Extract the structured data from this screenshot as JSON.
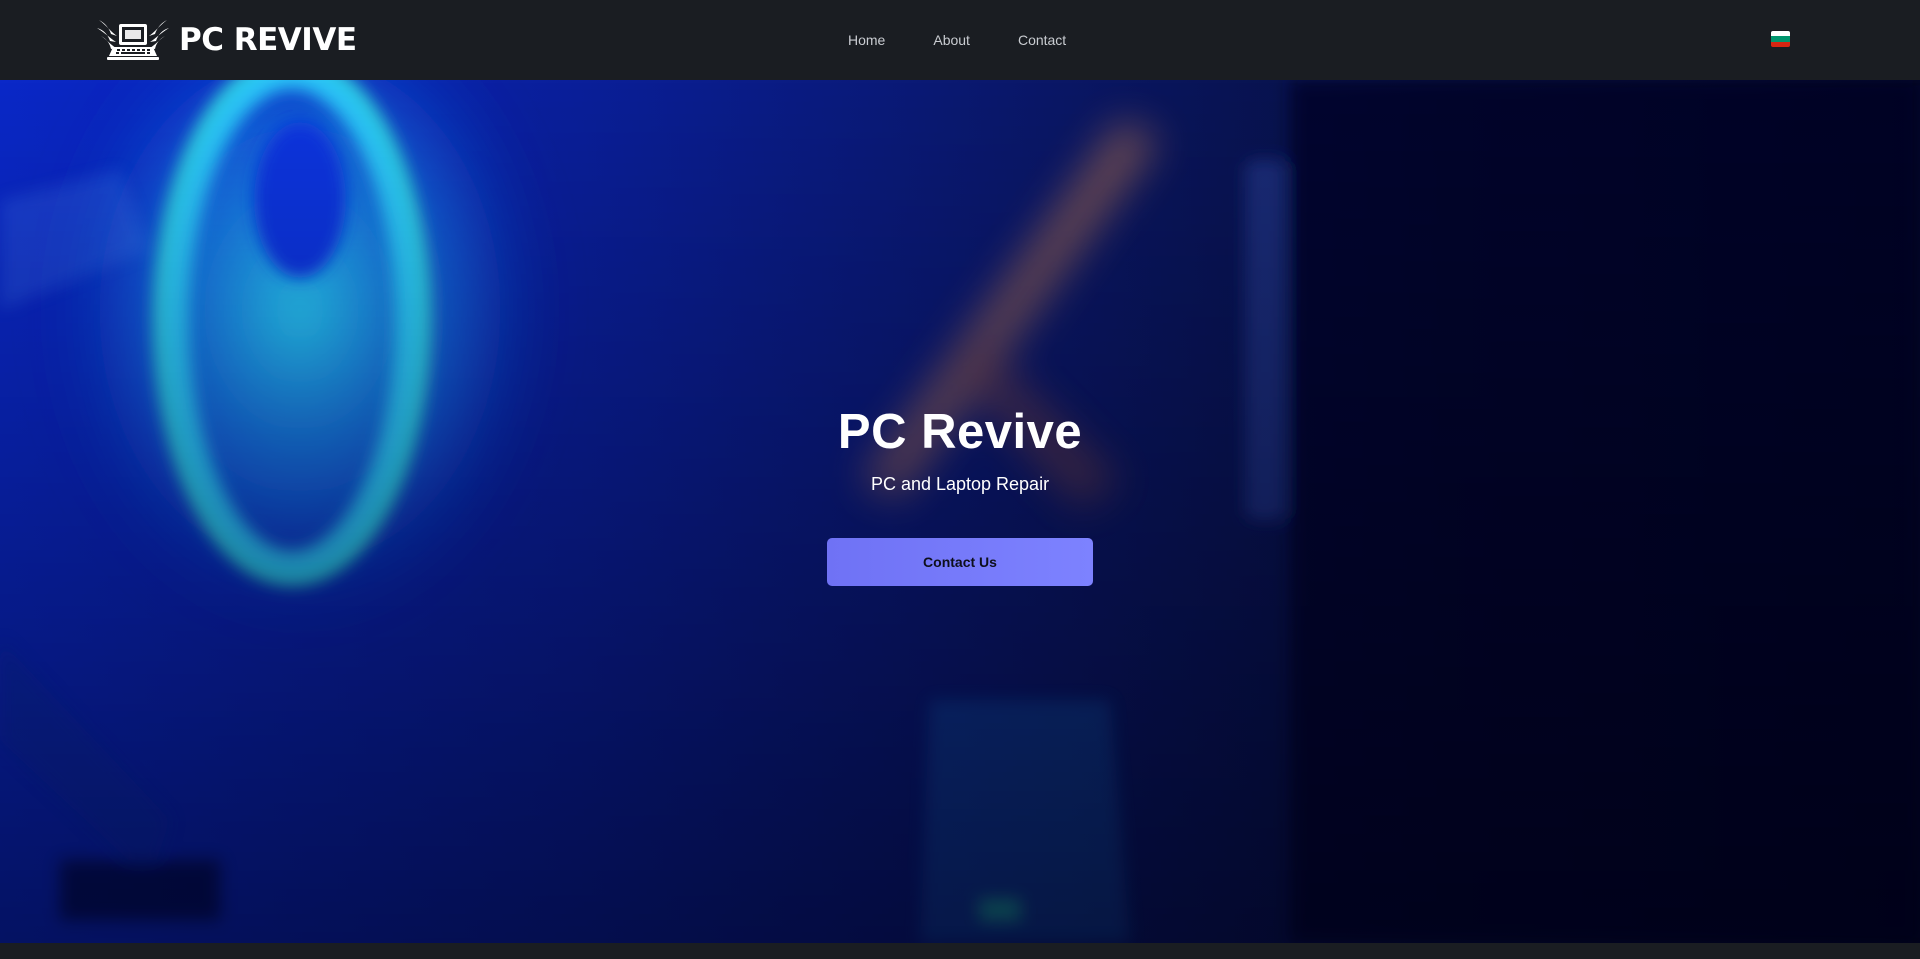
{
  "brand": {
    "logo_text": "PC REVIVE",
    "logo_icon": "winged-laptop-icon"
  },
  "nav": {
    "items": [
      {
        "label": "Home"
      },
      {
        "label": "About"
      },
      {
        "label": "Contact"
      }
    ],
    "language_flag": {
      "icon": "bulgarian-flag-icon",
      "colors": [
        "#ffffff",
        "#00966e",
        "#d62612"
      ]
    }
  },
  "hero": {
    "title": "PC Revive",
    "subtitle": "PC and Laptop Repair",
    "cta_label": "Contact Us",
    "cta_color": "#7478f8",
    "background": "blurred PC case interior with glowing blue fan"
  },
  "colors": {
    "navbar": "#1a1d22",
    "accent": "#7478f8",
    "hero_dark": "#060a2a"
  }
}
